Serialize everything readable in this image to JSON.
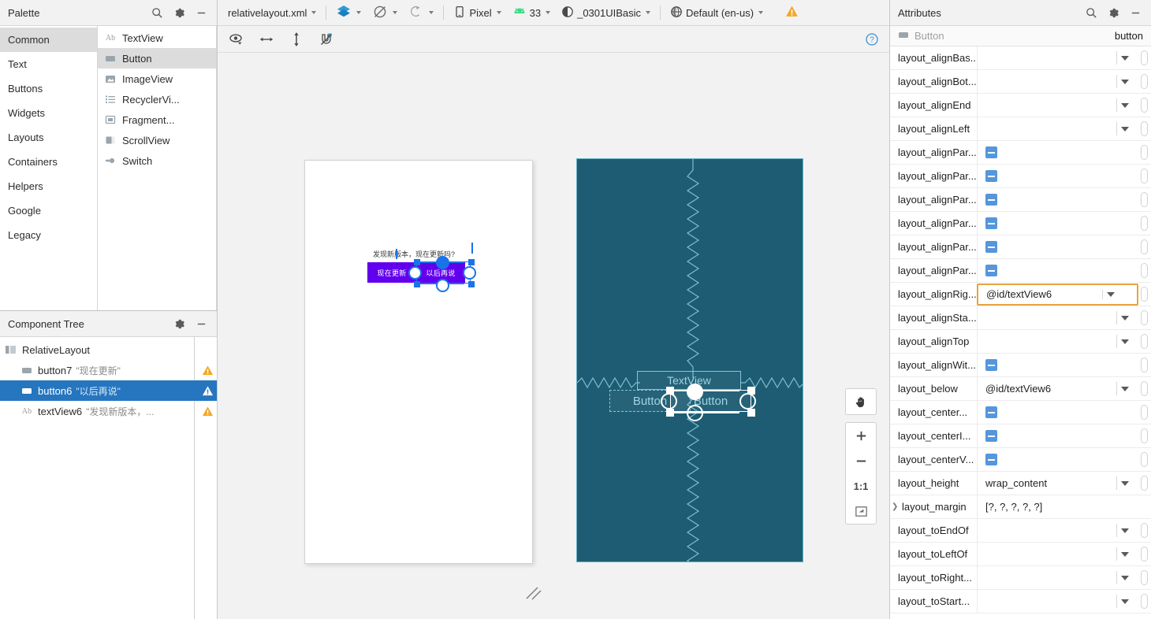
{
  "palette": {
    "title": "Palette",
    "icons": [
      "search-icon",
      "gear-icon",
      "minimize-icon"
    ],
    "groups": [
      {
        "label": "Common",
        "selected": true
      },
      {
        "label": "Text",
        "selected": false
      },
      {
        "label": "Buttons",
        "selected": false
      },
      {
        "label": "Widgets",
        "selected": false
      },
      {
        "label": "Layouts",
        "selected": false
      },
      {
        "label": "Containers",
        "selected": false
      },
      {
        "label": "Helpers",
        "selected": false
      },
      {
        "label": "Google",
        "selected": false
      },
      {
        "label": "Legacy",
        "selected": false
      }
    ],
    "items": [
      {
        "label": "TextView",
        "icon": "textview-icon",
        "selected": false
      },
      {
        "label": "Button",
        "icon": "button-icon",
        "selected": true
      },
      {
        "label": "ImageView",
        "icon": "imageview-icon",
        "selected": false
      },
      {
        "label": "RecyclerVi...",
        "icon": "recyclerview-icon",
        "selected": false
      },
      {
        "label": "Fragment...",
        "icon": "fragment-icon",
        "selected": false
      },
      {
        "label": "ScrollView",
        "icon": "scrollview-icon",
        "selected": false
      },
      {
        "label": "Switch",
        "icon": "switch-icon",
        "selected": false
      }
    ]
  },
  "component_tree": {
    "title": "Component Tree",
    "icons": [
      "gear-icon",
      "minimize-icon"
    ],
    "nodes": [
      {
        "id": "RelativeLayout",
        "sub": "",
        "icon": "relativelayout-icon",
        "indent": 0,
        "selected": false,
        "warning": false
      },
      {
        "id": "button7",
        "sub": "\"现在更新\"",
        "icon": "button-icon",
        "indent": 1,
        "selected": false,
        "warning": true
      },
      {
        "id": "button6",
        "sub": "\"以后再说\"",
        "icon": "button-icon",
        "indent": 1,
        "selected": true,
        "warning": true
      },
      {
        "id": "textView6",
        "sub": "\"发现新版本，...",
        "icon": "textview-icon",
        "indent": 1,
        "selected": false,
        "warning": true
      }
    ]
  },
  "toolbar": {
    "file_name": "relativelayout.xml",
    "design_mode_icon": "layers-icon",
    "blueprint_mode_icon": "blueprint-off-icon",
    "orientation_icon": "orientation-icon",
    "device": "Pixel",
    "device_icon": "phone-icon",
    "api_level": "33",
    "api_icon": "android-icon",
    "theme": "_0301UIBasic",
    "theme_icon": "theme-icon",
    "locale": "Default (en-us)",
    "locale_icon": "globe-icon",
    "warning_icon": "warning-icon"
  },
  "design_toolbar": {
    "icons": [
      {
        "name": "visibility-eye-icon"
      },
      {
        "name": "horizontal-arrows-icon"
      },
      {
        "name": "vertical-arrows-icon"
      },
      {
        "name": "magnet-off-icon"
      }
    ],
    "help_icon": "help-icon"
  },
  "canvas": {
    "design_preview": {
      "textview_text": "发现新版本，现在更新吗?",
      "button_update": "现在更新",
      "button_later": "以后再说"
    },
    "blueprint_preview": {
      "textview_label": "TextView",
      "button_label_1": "Button",
      "button_label_2": "Button"
    },
    "zoom_controls": [
      {
        "name": "pan-hand-button",
        "label": "✋"
      },
      {
        "name": "zoom-in-button",
        "label": "+"
      },
      {
        "name": "zoom-out-button",
        "label": "−"
      },
      {
        "name": "zoom-actual-button",
        "label": "1:1"
      },
      {
        "name": "zoom-fit-button",
        "label": "⛶"
      }
    ]
  },
  "attributes": {
    "title": "Attributes",
    "icons": [
      "search-icon",
      "gear-icon",
      "minimize-icon"
    ],
    "selected_type": "Button",
    "selected_id": "button",
    "rows": [
      {
        "name": "layout_alignBas...",
        "value": "",
        "control": "dropdown"
      },
      {
        "name": "layout_alignBot...",
        "value": "",
        "control": "dropdown"
      },
      {
        "name": "layout_alignEnd",
        "value": "",
        "control": "dropdown"
      },
      {
        "name": "layout_alignLeft",
        "value": "",
        "control": "dropdown"
      },
      {
        "name": "layout_alignPar...",
        "value": "",
        "control": "checkbox"
      },
      {
        "name": "layout_alignPar...",
        "value": "",
        "control": "checkbox"
      },
      {
        "name": "layout_alignPar...",
        "value": "",
        "control": "checkbox"
      },
      {
        "name": "layout_alignPar...",
        "value": "",
        "control": "checkbox"
      },
      {
        "name": "layout_alignPar...",
        "value": "",
        "control": "checkbox"
      },
      {
        "name": "layout_alignPar...",
        "value": "",
        "control": "checkbox"
      },
      {
        "name": "layout_alignRig...",
        "value": "@id/textView6",
        "control": "dropdown",
        "highlighted": true
      },
      {
        "name": "layout_alignSta...",
        "value": "",
        "control": "dropdown"
      },
      {
        "name": "layout_alignTop",
        "value": "",
        "control": "dropdown"
      },
      {
        "name": "layout_alignWit...",
        "value": "",
        "control": "checkbox"
      },
      {
        "name": "layout_below",
        "value": "@id/textView6",
        "control": "dropdown"
      },
      {
        "name": "layout_center...",
        "value": "",
        "control": "checkbox"
      },
      {
        "name": "layout_centerI...",
        "value": "",
        "control": "checkbox"
      },
      {
        "name": "layout_centerV...",
        "value": "",
        "control": "checkbox"
      },
      {
        "name": "layout_height",
        "value": "wrap_content",
        "control": "dropdown"
      },
      {
        "name": "layout_margin",
        "value": "[?, ?, ?, ?, ?]",
        "control": "expander"
      },
      {
        "name": "layout_toEndOf",
        "value": "",
        "control": "dropdown"
      },
      {
        "name": "layout_toLeftOf",
        "value": "",
        "control": "dropdown"
      },
      {
        "name": "layout_toRight...",
        "value": "",
        "control": "dropdown"
      },
      {
        "name": "layout_toStart...",
        "value": "",
        "control": "dropdown"
      }
    ]
  },
  "colors": {
    "selection_blue": "#2675bf",
    "accent_blue": "#1a73e8",
    "blueprint_bg": "#1d5c72",
    "blueprint_stroke": "#88c4d6",
    "button_purple": "#6200ee",
    "highlight_orange": "#e8a33d",
    "checkbox_blue": "#5596dc",
    "warning_orange": "#f5a623"
  }
}
